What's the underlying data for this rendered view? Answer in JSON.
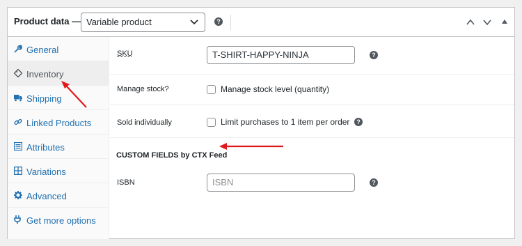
{
  "header": {
    "title": "Product data —",
    "product_type": "Variable product",
    "help": "?"
  },
  "sidebar": {
    "items": [
      {
        "label": "General",
        "icon": "wrench-icon"
      },
      {
        "label": "Inventory",
        "icon": "tag-icon"
      },
      {
        "label": "Shipping",
        "icon": "truck-icon"
      },
      {
        "label": "Linked Products",
        "icon": "link-icon"
      },
      {
        "label": "Attributes",
        "icon": "list-icon"
      },
      {
        "label": "Variations",
        "icon": "grid-icon"
      },
      {
        "label": "Advanced",
        "icon": "gear-icon"
      },
      {
        "label": "Get more options",
        "icon": "plugin-icon"
      }
    ],
    "active": "Inventory"
  },
  "inventory": {
    "sku_label": "SKU",
    "sku_value": "T-SHIRT-HAPPY-NINJA",
    "manage_stock_label": "Manage stock?",
    "manage_stock_checkbox": "Manage stock level (quantity)",
    "manage_stock_checked": false,
    "sold_individually_label": "Sold individually",
    "sold_individually_checkbox": "Limit purchases to 1 item per order",
    "sold_individually_checked": false,
    "custom_section_title": "CUSTOM FIELDS by CTX Feed",
    "isbn_label": "ISBN",
    "isbn_placeholder": "ISBN"
  },
  "colors": {
    "link": "#2271b1",
    "annotation_arrow": "#e0191b"
  }
}
